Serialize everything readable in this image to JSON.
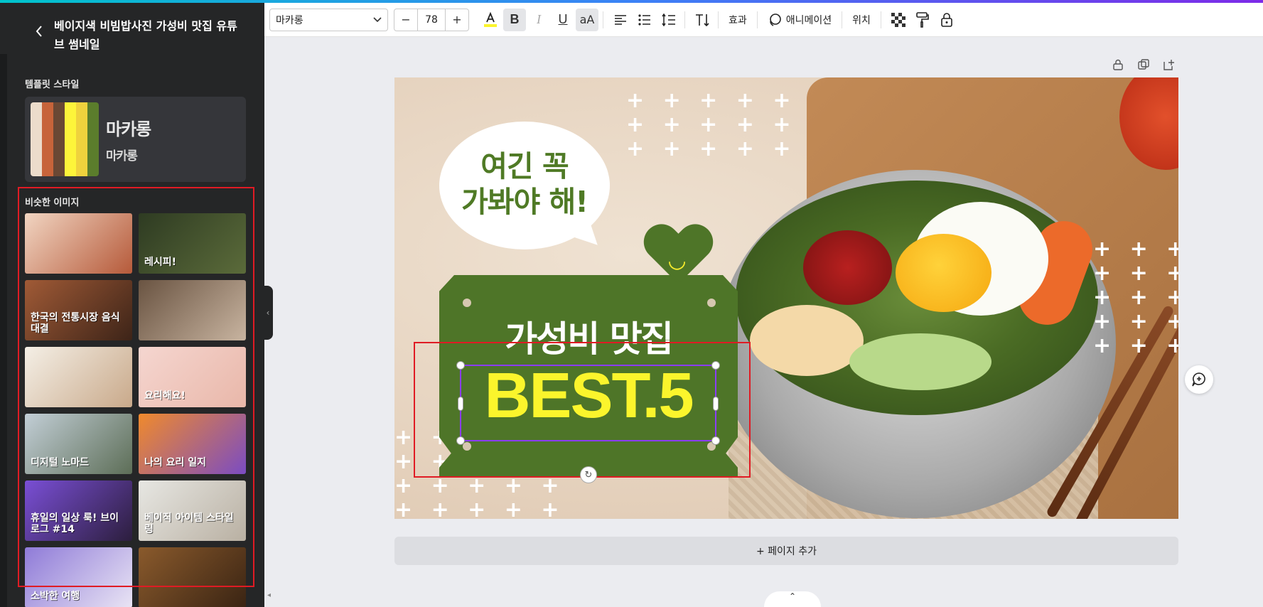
{
  "sidebar": {
    "title": "베이지색 비빔밥사진 가성비 맛집 유튜브 썸네일",
    "template_style_label": "템플릿 스타일",
    "style_name": "마카롱",
    "style_subname": "마카롱",
    "swatches": [
      "#ecdccb",
      "#c7643a",
      "#6a4834",
      "#fdf43a",
      "#efd23d",
      "#5b7d2c"
    ],
    "similar_label": "비슷한 이미지",
    "thumbnails": [
      {
        "text": "",
        "bg": "linear-gradient(135deg,#f1d5c2,#b65a3a)"
      },
      {
        "text": "레시피!",
        "bg": "linear-gradient(135deg,#2e3b22,#5b6b3a)"
      },
      {
        "text": "한국의 전통시장 음식 대결",
        "bg": "linear-gradient(135deg,#a05a36,#3d2418)"
      },
      {
        "text": "",
        "bg": "linear-gradient(135deg,#6a5442,#c8b4a0)"
      },
      {
        "text": "",
        "bg": "linear-gradient(135deg,#f4efe6,#c9a98a)"
      },
      {
        "text": "요리해요!",
        "bg": "linear-gradient(135deg,#f5d6d0,#e9b7a9)"
      },
      {
        "text": "디지털 노마드",
        "bg": "linear-gradient(135deg,#c2ced6,#5d6e57)"
      },
      {
        "text": "나의 요리 일지",
        "bg": "linear-gradient(135deg,#f08a2c,#7b4cc2)"
      },
      {
        "text": "휴일의 일상 룩! 브이로그 #14",
        "bg": "linear-gradient(135deg,#7a4fd6,#2c1e3d)"
      },
      {
        "text": "베이직 아이템 스타일링",
        "bg": "linear-gradient(135deg,#e7e7e3,#b9b0a2)"
      },
      {
        "text": "소박한 여행",
        "bg": "linear-gradient(135deg,#8f7bd8,#e9e4f4)"
      },
      {
        "text": "",
        "bg": "linear-gradient(135deg,#8a5a2c,#3a2413)"
      }
    ]
  },
  "toolbar": {
    "font": "마카롱",
    "font_size": "78",
    "minus": "−",
    "plus": "+",
    "effects": "효과",
    "animation": "애니메이션",
    "position": "위치"
  },
  "canvas": {
    "bubble_line1": "여긴 꼭",
    "bubble_line2": "가봐야 해!",
    "sign_title": "가성비 맛집",
    "sign_best": "BEST.5",
    "smile": "◡",
    "plus_pattern": "+ + + + +"
  },
  "add_page": "+ 페이지 추가",
  "colors": {
    "accent": "#8b3dff",
    "highlight": "#e01b24",
    "sign_green": "#4e7528",
    "best_yellow": "#fbf52c"
  }
}
